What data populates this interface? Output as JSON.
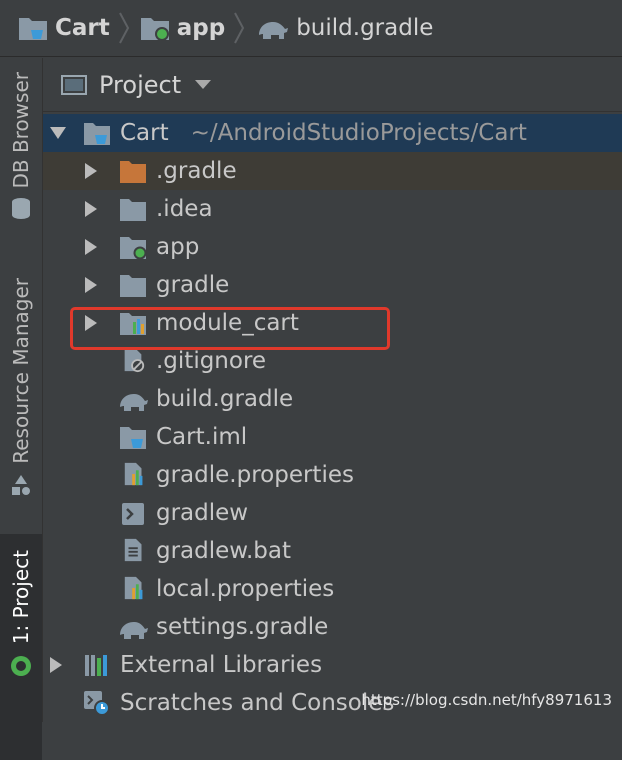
{
  "breadcrumb": [
    {
      "label": "Cart",
      "icon": "folder-icon"
    },
    {
      "label": "app",
      "icon": "module-folder-icon"
    },
    {
      "label": "build.gradle",
      "icon": "gradle-elephant-icon"
    }
  ],
  "tool_strip": {
    "db_browser": "DB Browser",
    "resource_manager": "Resource Manager",
    "project": "1: Project"
  },
  "project_panel": {
    "title": "Project",
    "root": {
      "name": "Cart",
      "path": "~/AndroidStudioProjects/Cart"
    },
    "items": [
      {
        "name": ".gradle",
        "icon": "orange-folder-icon",
        "expandable": true
      },
      {
        "name": ".idea",
        "icon": "folder-icon",
        "expandable": true
      },
      {
        "name": "app",
        "icon": "module-folder-icon",
        "expandable": true
      },
      {
        "name": "gradle",
        "icon": "folder-icon",
        "expandable": true
      },
      {
        "name": "module_cart",
        "icon": "library-module-folder-icon",
        "expandable": true
      },
      {
        "name": ".gitignore",
        "icon": "ignored-file-icon",
        "expandable": false
      },
      {
        "name": "build.gradle",
        "icon": "gradle-elephant-icon",
        "expandable": false
      },
      {
        "name": "Cart.iml",
        "icon": "iml-folder-icon",
        "expandable": false
      },
      {
        "name": "gradle.properties",
        "icon": "properties-file-icon",
        "expandable": false
      },
      {
        "name": "gradlew",
        "icon": "shell-script-icon",
        "expandable": false
      },
      {
        "name": "gradlew.bat",
        "icon": "text-file-icon",
        "expandable": false
      },
      {
        "name": "local.properties",
        "icon": "properties-file-icon",
        "expandable": false
      },
      {
        "name": "settings.gradle",
        "icon": "gradle-elephant-icon",
        "expandable": false
      }
    ],
    "external_libraries": "External Libraries",
    "scratches": "Scratches and Consoles"
  },
  "watermark": "https://blog.csdn.net/hfy8971613",
  "colors": {
    "highlight_box": "#e0392b",
    "selected_row": "#1f3a55",
    "accent_green": "#4caf50"
  }
}
